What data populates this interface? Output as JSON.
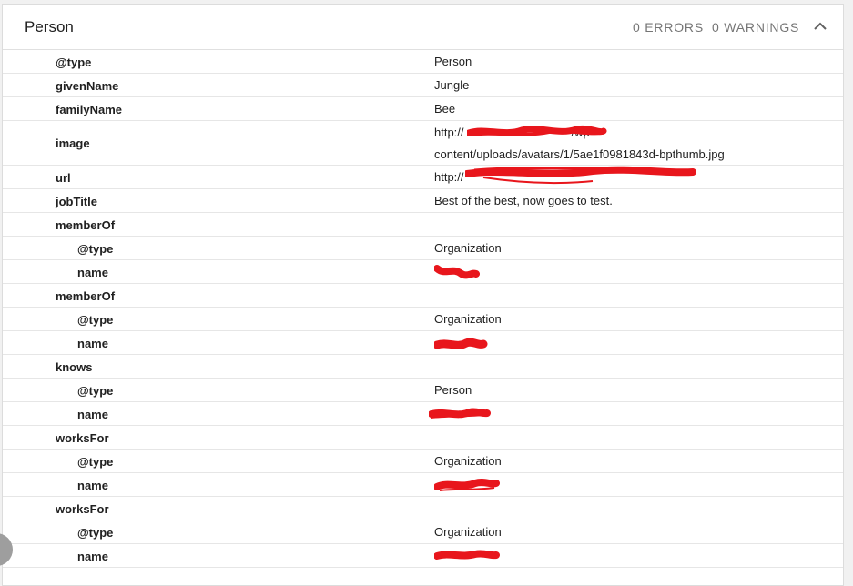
{
  "panel": {
    "title": "Person",
    "errors_label": "0 ERRORS",
    "warnings_label": "0 WARNINGS",
    "collapse_icon": "chevron-up-icon"
  },
  "rows": [
    {
      "key": "@type",
      "value": "Person"
    },
    {
      "key": "givenName",
      "value": "Jungle"
    },
    {
      "key": "familyName",
      "value": "Bee"
    },
    {
      "key": "image",
      "value_line1": "http://",
      "value_line1_suffix": "/wp-",
      "value_line2": "content/uploads/avatars/1/5ae1f0981843d-bpthumb.jpg"
    },
    {
      "key": "url",
      "value": "http://"
    },
    {
      "key": "jobTitle",
      "value": "Best of the best, now goes to test."
    },
    {
      "key": "memberOf",
      "value": ""
    },
    {
      "key": "@type",
      "value": "Organization"
    },
    {
      "key": "name",
      "value": ""
    },
    {
      "key": "memberOf",
      "value": ""
    },
    {
      "key": "@type",
      "value": "Organization"
    },
    {
      "key": "name",
      "value": ""
    },
    {
      "key": "knows",
      "value": ""
    },
    {
      "key": "@type",
      "value": "Person"
    },
    {
      "key": "name",
      "value": ""
    },
    {
      "key": "worksFor",
      "value": ""
    },
    {
      "key": "@type",
      "value": "Organization"
    },
    {
      "key": "name",
      "value": ""
    },
    {
      "key": "worksFor",
      "value": ""
    },
    {
      "key": "@type",
      "value": "Organization"
    },
    {
      "key": "name",
      "value": ""
    }
  ],
  "colors": {
    "redaction": "#e8161c",
    "header_meta": "#757575"
  }
}
